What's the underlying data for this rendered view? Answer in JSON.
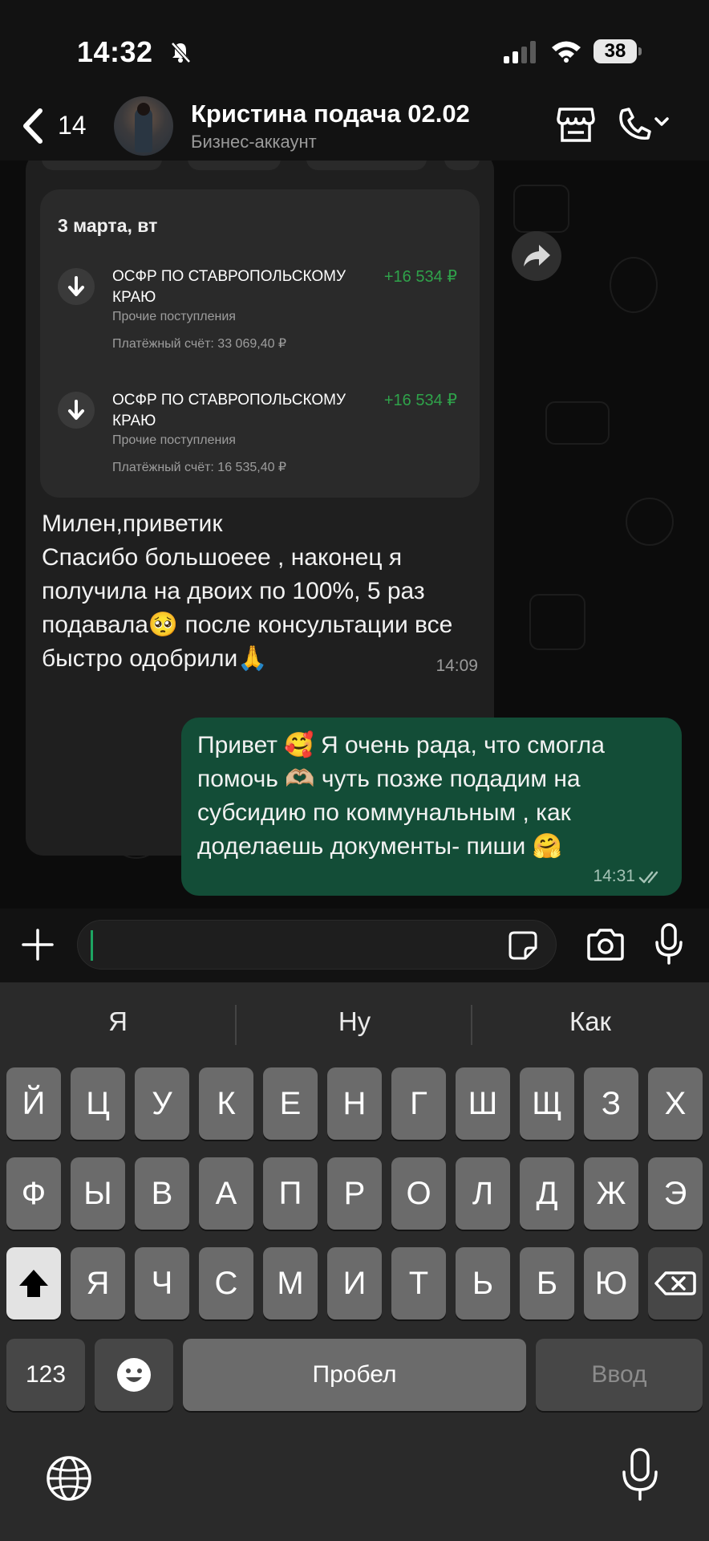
{
  "status_bar": {
    "time": "14:32",
    "battery": "38"
  },
  "header": {
    "back_count": "14",
    "contact_name": "Кристина подача 02.02",
    "contact_subtitle": "Бизнес-аккаунт"
  },
  "incoming": {
    "card_date": "3 марта, вт",
    "operations": [
      {
        "title": "ОСФР ПО СТАВРОПОЛЬСКОМУ КРАЮ",
        "amount": "+16 534 ₽",
        "category": "Прочие поступления",
        "account": "Платёжный счёт: 33 069,40 ₽"
      },
      {
        "title": "ОСФР ПО СТАВРОПОЛЬСКОМУ КРАЮ",
        "amount": "+16 534 ₽",
        "category": "Прочие поступления",
        "account": "Платёжный счёт: 16 535,40 ₽"
      }
    ],
    "text": "Милен,приветик\nСпасибо большоеее , наконец я получила на двоих по 100%, 5 раз подавала🥺 после консультации все быстро одобрили🙏",
    "time": "14:09"
  },
  "outgoing": {
    "text": "Привет 🥰 Я очень рада, что смогла помочь 🫶🏼 чуть позже подадим на субсидию по коммунальным , как доделаешь документы- пиши 🤗",
    "time": "14:31"
  },
  "input": {
    "value": ""
  },
  "keyboard": {
    "suggestions": [
      "Я",
      "Ну",
      "Как"
    ],
    "row1": [
      "Й",
      "Ц",
      "У",
      "К",
      "Е",
      "Н",
      "Г",
      "Ш",
      "Щ",
      "З",
      "Х"
    ],
    "row2": [
      "Ф",
      "Ы",
      "В",
      "А",
      "П",
      "Р",
      "О",
      "Л",
      "Д",
      "Ж",
      "Э"
    ],
    "row3": [
      "Я",
      "Ч",
      "С",
      "М",
      "И",
      "Т",
      "Ь",
      "Б",
      "Ю"
    ],
    "numbers_label": "123",
    "space_label": "Пробел",
    "return_label": "Ввод"
  },
  "icons": {
    "bell": "bell-slash-icon",
    "back": "chevron-left-icon",
    "store": "storefront-icon",
    "call": "phone-icon",
    "forward": "forward-arrow-icon",
    "plus": "plus-icon",
    "sticker": "sticker-icon",
    "camera": "camera-icon",
    "mic": "microphone-icon",
    "globe": "globe-icon",
    "shift": "shift-icon",
    "backspace": "backspace-icon",
    "emoji": "emoji-icon"
  },
  "colors": {
    "incoming_bubble": "#1f1f1f",
    "outgoing_bubble": "#134d37",
    "amount_green": "#2fa24a",
    "cursor_green": "#1da462"
  }
}
